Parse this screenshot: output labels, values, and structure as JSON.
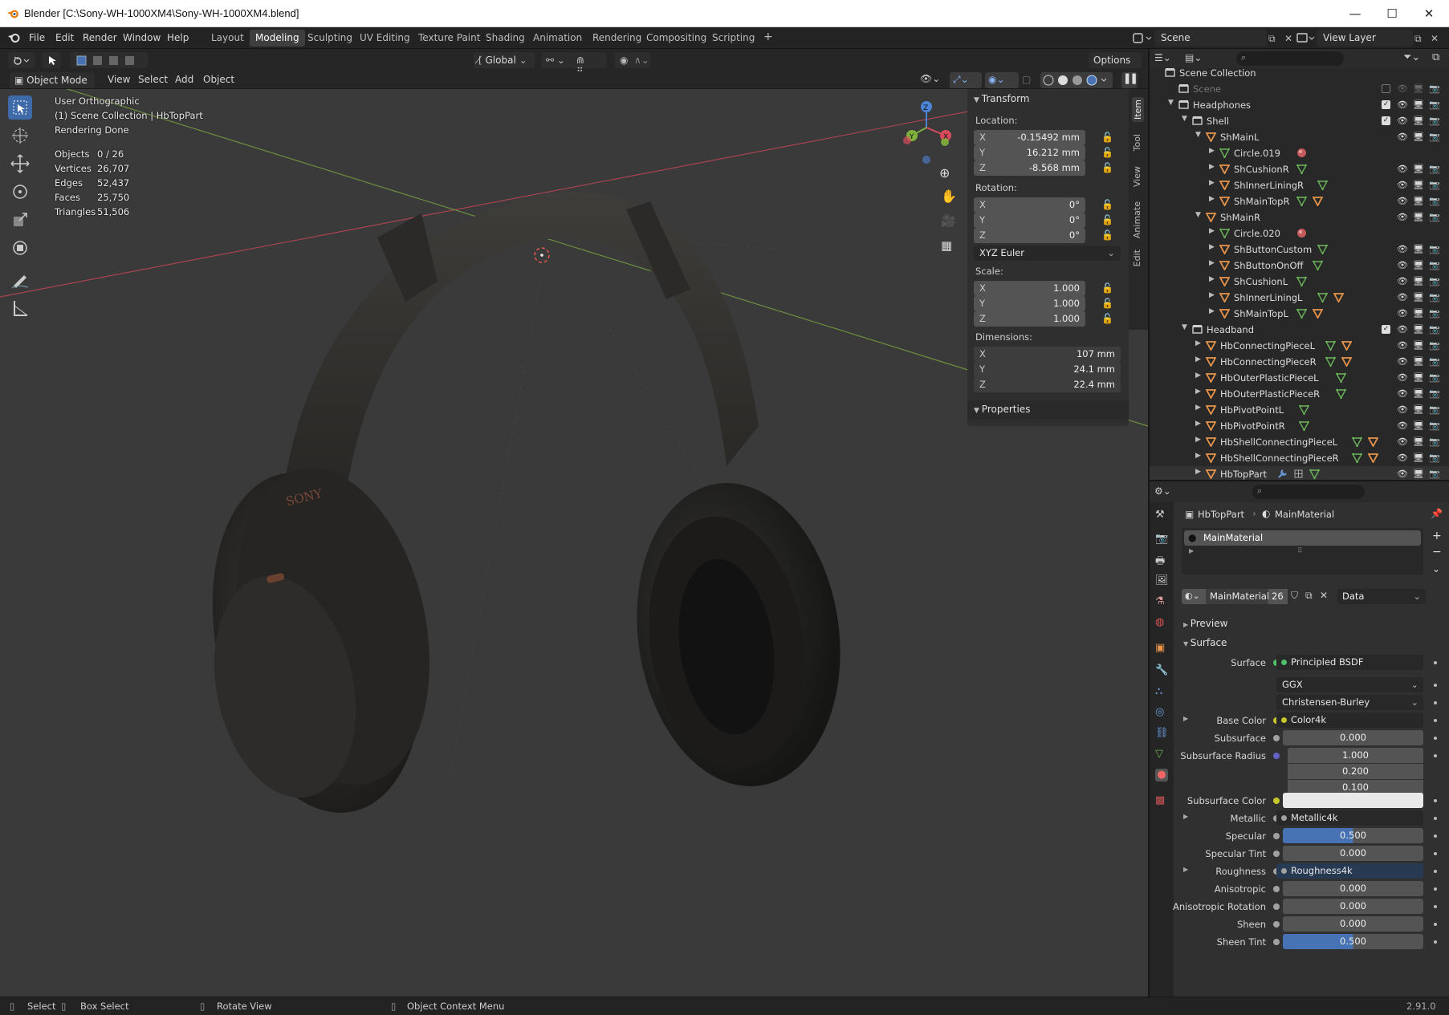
{
  "window": {
    "title": "Blender [C:\\Sony-WH-1000XM4\\Sony-WH-1000XM4.blend]"
  },
  "menu": [
    "File",
    "Edit",
    "Render",
    "Window",
    "Help"
  ],
  "workspaces": [
    "Layout",
    "Modeling",
    "Sculpting",
    "UV Editing",
    "Texture Paint",
    "Shading",
    "Animation",
    "Rendering",
    "Compositing",
    "Scripting"
  ],
  "active_workspace": "Modeling",
  "scene": {
    "name": "Scene",
    "view_layer": "View Layer"
  },
  "tool_header": {
    "orientation": "Global",
    "options": "Options"
  },
  "view_header": {
    "mode": "Object Mode",
    "items": [
      "View",
      "Select",
      "Add",
      "Object"
    ]
  },
  "overlay_info": {
    "view_name": "User Orthographic",
    "collection": "(1) Scene Collection | HbTopPart",
    "status": "Rendering Done",
    "stats": [
      {
        "label": "Objects",
        "value": "0 / 26"
      },
      {
        "label": "Vertices",
        "value": "26,707"
      },
      {
        "label": "Edges",
        "value": "52,437"
      },
      {
        "label": "Faces",
        "value": "25,750"
      },
      {
        "label": "Triangles",
        "value": "51,506"
      }
    ]
  },
  "model_logo": "SONY",
  "gizmo": {
    "x": "X",
    "y": "Y",
    "z": "Z"
  },
  "npanel": {
    "transform": "Transform",
    "location_label": "Location:",
    "location": [
      {
        "axis": "X",
        "value": "-0.15492 mm"
      },
      {
        "axis": "Y",
        "value": "16.212 mm"
      },
      {
        "axis": "Z",
        "value": "-8.568 mm"
      }
    ],
    "rotation_label": "Rotation:",
    "rotation": [
      {
        "axis": "X",
        "value": "0°"
      },
      {
        "axis": "Y",
        "value": "0°"
      },
      {
        "axis": "Z",
        "value": "0°"
      }
    ],
    "rotation_mode": "XYZ Euler",
    "scale_label": "Scale:",
    "scale": [
      {
        "axis": "X",
        "value": "1.000"
      },
      {
        "axis": "Y",
        "value": "1.000"
      },
      {
        "axis": "Z",
        "value": "1.000"
      }
    ],
    "dimensions_label": "Dimensions:",
    "dimensions": [
      {
        "axis": "X",
        "value": "107 mm"
      },
      {
        "axis": "Y",
        "value": "24.1 mm"
      },
      {
        "axis": "Z",
        "value": "22.4 mm"
      }
    ],
    "properties": "Properties",
    "tabs": [
      "Item",
      "Tool",
      "View",
      "Animate",
      "Edit"
    ]
  },
  "outliner": {
    "rows": [
      {
        "name": "Scene Collection",
        "depth": 0,
        "type": "coll",
        "arrow": "",
        "icons": []
      },
      {
        "name": "Scene",
        "depth": 1,
        "type": "coll",
        "arrow": "",
        "icons": [],
        "dim": true
      },
      {
        "name": "Headphones",
        "depth": 1,
        "type": "coll",
        "arrow": "▼",
        "icons": []
      },
      {
        "name": "Shell",
        "depth": 2,
        "type": "coll",
        "arrow": "▼",
        "icons": []
      },
      {
        "name": "ShMainL",
        "depth": 3,
        "type": "obj",
        "arrow": "▼",
        "icons": []
      },
      {
        "name": "Circle.019",
        "depth": 4,
        "type": "mesh",
        "arrow": "▶",
        "icons": [
          "mat"
        ]
      },
      {
        "name": "ShCushionR",
        "depth": 4,
        "type": "obj",
        "arrow": "▶",
        "icons": [
          "mesh"
        ]
      },
      {
        "name": "ShInnerLiningR",
        "depth": 4,
        "type": "obj",
        "arrow": "▶",
        "icons": [
          "mesh"
        ]
      },
      {
        "name": "ShMainTopR",
        "depth": 4,
        "type": "obj",
        "arrow": "▶",
        "icons": [
          "mesh",
          "obj"
        ]
      },
      {
        "name": "ShMainR",
        "depth": 3,
        "type": "obj",
        "arrow": "▼",
        "icons": []
      },
      {
        "name": "Circle.020",
        "depth": 4,
        "type": "mesh",
        "arrow": "▶",
        "icons": [
          "mat"
        ]
      },
      {
        "name": "ShButtonCustom",
        "depth": 4,
        "type": "obj",
        "arrow": "▶",
        "icons": [
          "mesh"
        ]
      },
      {
        "name": "ShButtonOnOff",
        "depth": 4,
        "type": "obj",
        "arrow": "▶",
        "icons": [
          "mesh"
        ]
      },
      {
        "name": "ShCushionL",
        "depth": 4,
        "type": "obj",
        "arrow": "▶",
        "icons": [
          "mesh"
        ]
      },
      {
        "name": "ShInnerLiningL",
        "depth": 4,
        "type": "obj",
        "arrow": "▶",
        "icons": [
          "mesh",
          "obj"
        ]
      },
      {
        "name": "ShMainTopL",
        "depth": 4,
        "type": "obj",
        "arrow": "▶",
        "icons": [
          "mesh",
          "obj"
        ]
      },
      {
        "name": "Headband",
        "depth": 2,
        "type": "coll",
        "arrow": "▼",
        "icons": []
      },
      {
        "name": "HbConnectingPieceL",
        "depth": 3,
        "type": "obj",
        "arrow": "▶",
        "icons": [
          "mesh",
          "obj"
        ]
      },
      {
        "name": "HbConnectingPieceR",
        "depth": 3,
        "type": "obj",
        "arrow": "▶",
        "icons": [
          "mesh",
          "obj"
        ]
      },
      {
        "name": "HbOuterPlasticPieceL",
        "depth": 3,
        "type": "obj",
        "arrow": "▶",
        "icons": [
          "mesh"
        ]
      },
      {
        "name": "HbOuterPlasticPieceR",
        "depth": 3,
        "type": "obj",
        "arrow": "▶",
        "icons": [
          "mesh"
        ]
      },
      {
        "name": "HbPivotPointL",
        "depth": 3,
        "type": "obj",
        "arrow": "▶",
        "icons": [
          "mesh"
        ]
      },
      {
        "name": "HbPivotPointR",
        "depth": 3,
        "type": "obj",
        "arrow": "▶",
        "icons": [
          "mesh"
        ]
      },
      {
        "name": "HbShellConnectingPieceL",
        "depth": 3,
        "type": "obj",
        "arrow": "▶",
        "icons": [
          "mesh",
          "obj"
        ]
      },
      {
        "name": "HbShellConnectingPieceR",
        "depth": 3,
        "type": "obj",
        "arrow": "▶",
        "icons": [
          "mesh",
          "obj"
        ]
      },
      {
        "name": "HbTopPart",
        "depth": 3,
        "type": "obj",
        "arrow": "▶",
        "icons": [
          "wrench",
          "mod",
          "mesh"
        ]
      }
    ]
  },
  "properties": {
    "object": "HbTopPart",
    "material": "MainMaterial",
    "slot": "MainMaterial",
    "users": "26",
    "link": "Data",
    "preview": "Preview",
    "surface_section": "Surface",
    "fields": [
      {
        "label": "Surface",
        "kind": "link",
        "value": "Principled BSDF",
        "sock": "#4fbf6a"
      },
      {
        "label": "",
        "kind": "select",
        "value": "GGX"
      },
      {
        "label": "",
        "kind": "select",
        "value": "Christensen-Burley"
      },
      {
        "label": "Base Color",
        "kind": "link",
        "value": "Color4k",
        "sock": "#c7c729",
        "expand": true
      },
      {
        "label": "Subsurface",
        "kind": "num",
        "value": "0.000",
        "sock": "#a1a1a1"
      },
      {
        "label": "Subsurface Radius",
        "kind": "vec",
        "value": [
          "1.000",
          "0.200",
          "0.100"
        ],
        "sock": "#6363c7"
      },
      {
        "label": "Subsurface Color",
        "kind": "color",
        "value": "#e9e9e9",
        "sock": "#c7c729"
      },
      {
        "label": "Metallic",
        "kind": "link",
        "value": "Metallic4k",
        "sock": "#a1a1a1",
        "expand": true
      },
      {
        "label": "Specular",
        "kind": "num",
        "value": "0.500",
        "fill": 0.5,
        "sock": "#a1a1a1"
      },
      {
        "label": "Specular Tint",
        "kind": "num",
        "value": "0.000",
        "sock": "#a1a1a1"
      },
      {
        "label": "Roughness",
        "kind": "link",
        "value": "Roughness4k",
        "sock": "#a1a1a1",
        "expand": true,
        "hl": true
      },
      {
        "label": "Anisotropic",
        "kind": "num",
        "value": "0.000",
        "sock": "#a1a1a1"
      },
      {
        "label": "Anisotropic Rotation",
        "kind": "num",
        "value": "0.000",
        "sock": "#a1a1a1"
      },
      {
        "label": "Sheen",
        "kind": "num",
        "value": "0.000",
        "sock": "#a1a1a1"
      },
      {
        "label": "Sheen Tint",
        "kind": "num",
        "value": "0.500",
        "fill": 0.5,
        "sock": "#a1a1a1"
      }
    ]
  },
  "statusbar": {
    "items": [
      "Select",
      "Box Select",
      "Rotate View",
      "Object Context Menu"
    ],
    "version": "2.91.0"
  },
  "colors": {
    "accent": "#4772b3",
    "object_orange": "#e8954b",
    "mesh_green": "#6ab55a",
    "collection_white": "#cfcfcf"
  }
}
